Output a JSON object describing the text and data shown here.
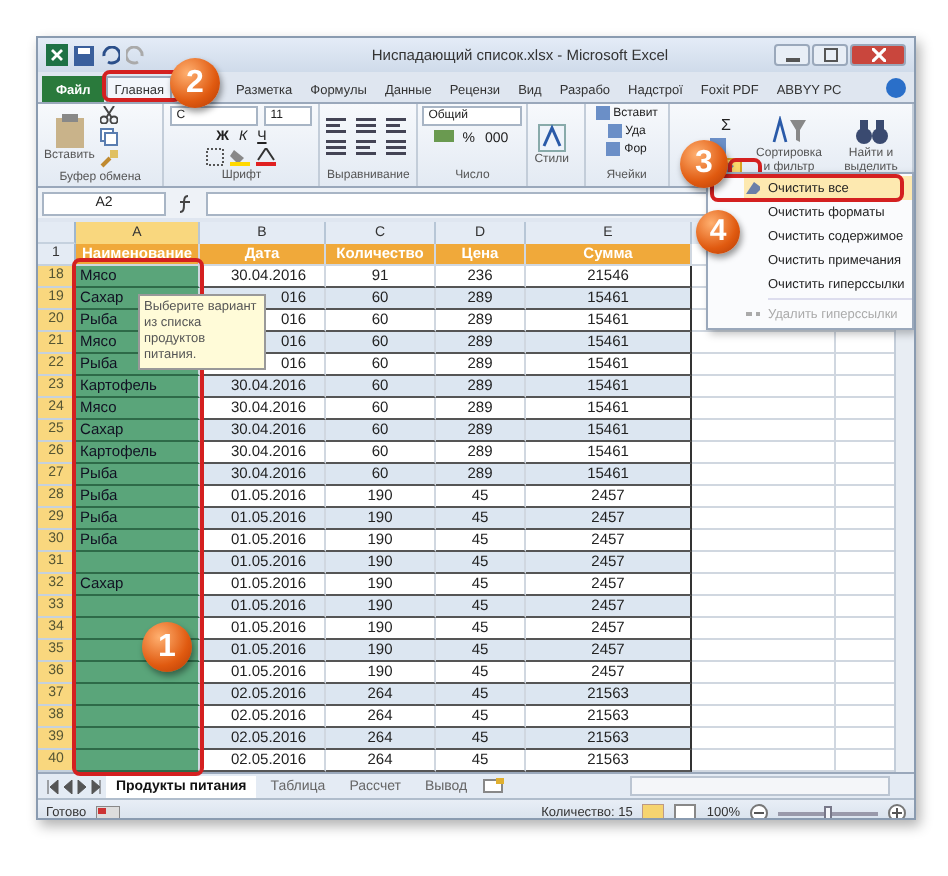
{
  "window": {
    "title": "Ниспадающий список.xlsx - Microsoft Excel"
  },
  "tabs": [
    {
      "label": "Файл",
      "selected": false,
      "kind": "file"
    },
    {
      "label": "Главная",
      "selected": true,
      "kind": "tab"
    },
    {
      "label": "Разметка",
      "selected": false,
      "kind": "tab"
    },
    {
      "label": "Формулы",
      "selected": false,
      "kind": "tab"
    },
    {
      "label": "Данные",
      "selected": false,
      "kind": "tab"
    },
    {
      "label": "Рецензи",
      "selected": false,
      "kind": "tab"
    },
    {
      "label": "Вид",
      "selected": false,
      "kind": "tab"
    },
    {
      "label": "Разрабо",
      "selected": false,
      "kind": "tab"
    },
    {
      "label": "Надстрої",
      "selected": false,
      "kind": "tab"
    },
    {
      "label": "Foxit PDF",
      "selected": false,
      "kind": "tab"
    },
    {
      "label": "ABBYY PC",
      "selected": false,
      "kind": "tab"
    }
  ],
  "ribbon": {
    "clipboard": {
      "paste": "Вставить",
      "label": "Буфер обмена"
    },
    "font": {
      "name": "C",
      "size": "11",
      "styles": [
        "Ж",
        "К",
        "Ч"
      ],
      "label": "Шрифт"
    },
    "alignment": {
      "label": "Выравнивание"
    },
    "number": {
      "format": "Общий",
      "percent": "%",
      "thousands": "000",
      "label": "Число"
    },
    "styles": {
      "button": "Стили"
    },
    "cells": {
      "buttons": [
        "Вставит",
        "Уда",
        "Фор"
      ],
      "label": "Ячейки"
    },
    "editing": {
      "sum": "Σ",
      "sort": "Сортировка и фильтр",
      "find": "Найти и выделить"
    }
  },
  "formula_bar": {
    "name_box": "A2"
  },
  "columns": [
    "A",
    "B",
    "C",
    "D",
    "E"
  ],
  "header_row": {
    "number": "1",
    "cells": [
      "Наименование",
      "Дата",
      "Количество",
      "Цена",
      "Сумма"
    ]
  },
  "rows": [
    {
      "number": "18",
      "cells": [
        "Мясо",
        "30.04.2016",
        "91",
        "236",
        "21546"
      ]
    },
    {
      "number": "19",
      "cells": [
        "Сахар",
        "016",
        "60",
        "289",
        "15461"
      ]
    },
    {
      "number": "20",
      "cells": [
        "Рыба",
        "016",
        "60",
        "289",
        "15461"
      ]
    },
    {
      "number": "21",
      "cells": [
        "Мясо",
        "016",
        "60",
        "289",
        "15461"
      ]
    },
    {
      "number": "22",
      "cells": [
        "Рыба",
        "016",
        "60",
        "289",
        "15461"
      ]
    },
    {
      "number": "23",
      "cells": [
        "Картофель",
        "30.04.2016",
        "60",
        "289",
        "15461"
      ]
    },
    {
      "number": "24",
      "cells": [
        "Мясо",
        "30.04.2016",
        "60",
        "289",
        "15461"
      ]
    },
    {
      "number": "25",
      "cells": [
        "Сахар",
        "30.04.2016",
        "60",
        "289",
        "15461"
      ]
    },
    {
      "number": "26",
      "cells": [
        "Картофель",
        "30.04.2016",
        "60",
        "289",
        "15461"
      ]
    },
    {
      "number": "27",
      "cells": [
        "Рыба",
        "30.04.2016",
        "60",
        "289",
        "15461"
      ]
    },
    {
      "number": "28",
      "cells": [
        "Рыба",
        "01.05.2016",
        "190",
        "45",
        "2457"
      ]
    },
    {
      "number": "29",
      "cells": [
        "Рыба",
        "01.05.2016",
        "190",
        "45",
        "2457"
      ]
    },
    {
      "number": "30",
      "cells": [
        "Рыба",
        "01.05.2016",
        "190",
        "45",
        "2457"
      ]
    },
    {
      "number": "31",
      "cells": [
        "",
        "01.05.2016",
        "190",
        "45",
        "2457"
      ]
    },
    {
      "number": "32",
      "cells": [
        "Сахар",
        "01.05.2016",
        "190",
        "45",
        "2457"
      ]
    },
    {
      "number": "33",
      "cells": [
        "",
        "01.05.2016",
        "190",
        "45",
        "2457"
      ]
    },
    {
      "number": "34",
      "cells": [
        "",
        "01.05.2016",
        "190",
        "45",
        "2457"
      ]
    },
    {
      "number": "35",
      "cells": [
        "",
        "01.05.2016",
        "190",
        "45",
        "2457"
      ]
    },
    {
      "number": "36",
      "cells": [
        "",
        "01.05.2016",
        "190",
        "45",
        "2457"
      ]
    },
    {
      "number": "37",
      "cells": [
        "",
        "02.05.2016",
        "264",
        "45",
        "21563"
      ]
    },
    {
      "number": "38",
      "cells": [
        "",
        "02.05.2016",
        "264",
        "45",
        "21563"
      ]
    },
    {
      "number": "39",
      "cells": [
        "",
        "02.05.2016",
        "264",
        "45",
        "21563"
      ]
    },
    {
      "number": "40",
      "cells": [
        "",
        "02.05.2016",
        "264",
        "45",
        "21563"
      ]
    }
  ],
  "tooltip": "Выберите вариант из списка продуктов питания.",
  "menu": [
    {
      "label": "Очистить все",
      "selected": true,
      "disabled": false,
      "kind": "eraser"
    },
    {
      "label": "Очистить форматы",
      "selected": false,
      "disabled": false,
      "kind": "text"
    },
    {
      "label": "Очистить содержимое",
      "selected": false,
      "disabled": false,
      "kind": "text"
    },
    {
      "label": "Очистить примечания",
      "selected": false,
      "disabled": false,
      "kind": "text"
    },
    {
      "label": "Очистить гиперссылки",
      "selected": false,
      "disabled": false,
      "kind": "text"
    },
    {
      "label": "Удалить гиперссылки",
      "selected": false,
      "disabled": true,
      "kind": "unlink"
    }
  ],
  "callouts": [
    "1",
    "2",
    "3",
    "4"
  ],
  "sheet_tabs": [
    {
      "label": "Продукты питания",
      "selected": true
    },
    {
      "label": "Таблица",
      "selected": false
    },
    {
      "label": "Рассчет",
      "selected": false
    },
    {
      "label": "Вывод",
      "selected": false
    }
  ],
  "status_bar": {
    "ready": "Готово",
    "count": "Количество: 15",
    "zoom": "100%",
    "zoom_slider": {
      "level": 0.5
    }
  }
}
